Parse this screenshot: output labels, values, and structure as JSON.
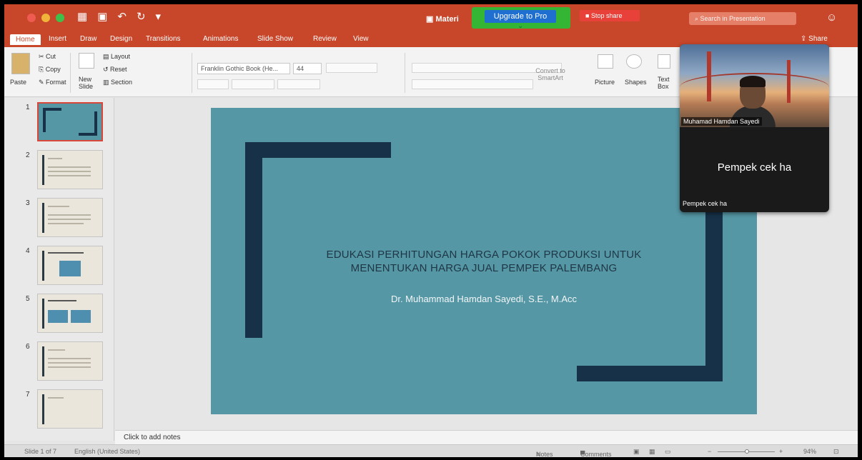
{
  "titlebar": {
    "doc_title": "Materi",
    "upgrade_label": "Upgrade to Pro",
    "stop_share_label": "Stop share",
    "search_placeholder": "Search in Presentation"
  },
  "tabs": [
    "Home",
    "Insert",
    "Draw",
    "Design",
    "Transitions",
    "Animations",
    "Slide Show",
    "Review",
    "View"
  ],
  "share_label": "Share",
  "ribbon": {
    "paste": "Paste",
    "cut": "Cut",
    "copy": "Copy",
    "format": "Format",
    "new_slide": "New Slide",
    "layout": "Layout",
    "reset": "Reset",
    "section": "Section",
    "font_name": "Franklin Gothic Book (He...",
    "font_size": "44",
    "convert_smartart": "Convert to SmartArt",
    "picture": "Picture",
    "shapes": "Shapes",
    "text_box": "Text Box"
  },
  "thumbnails": [
    {
      "num": "1"
    },
    {
      "num": "2"
    },
    {
      "num": "3"
    },
    {
      "num": "4"
    },
    {
      "num": "5"
    },
    {
      "num": "6"
    },
    {
      "num": "7"
    }
  ],
  "slide": {
    "title_line1": "EDUKASI PERHITUNGAN HARGA POKOK PRODUKSI UNTUK",
    "title_line2": "MENENTUKAN HARGA JUAL PEMPEK PALEMBANG",
    "subtitle": "Dr. Muhammad Hamdan Sayedi, S.E., M.Acc"
  },
  "notes_placeholder": "Click to add notes",
  "status": {
    "slide_info": "Slide 1 of 7",
    "language": "English (United States)",
    "notes": "Notes",
    "comments": "Comments",
    "zoom": "94%"
  },
  "video": {
    "participant_name": "Muhamad Hamdan Sayedi",
    "big_text": "Pempek cek ha",
    "small_text": "Pempek cek ha"
  },
  "colors": {
    "accent": "#c8462a",
    "slide_bg": "#5597a5",
    "slide_deco": "#163148"
  }
}
